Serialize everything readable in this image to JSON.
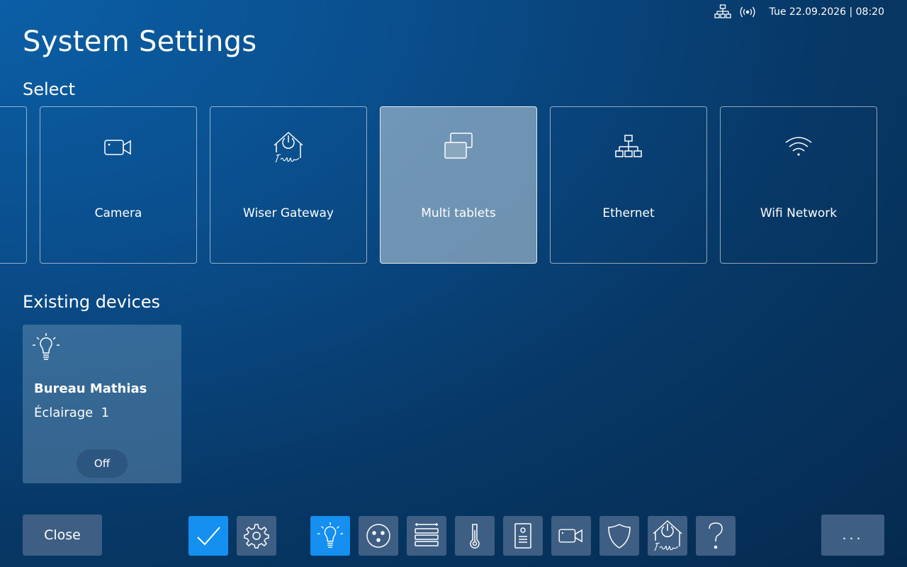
{
  "status": {
    "network_icon": "network-icon",
    "wireless_icon": "wireless-signal-icon",
    "datetime": "Tue 22.09.2026 | 08:20"
  },
  "page": {
    "title": "System Settings"
  },
  "select": {
    "heading": "Select",
    "tiles": [
      {
        "label": "",
        "icon": "none"
      },
      {
        "label": "Camera",
        "icon": "camera-icon"
      },
      {
        "label": "Wiser Gateway",
        "icon": "wiser-gateway-icon"
      },
      {
        "label": "Multi tablets",
        "icon": "multi-tablets-icon",
        "selected": true
      },
      {
        "label": "Ethernet",
        "icon": "ethernet-icon"
      },
      {
        "label": "Wifi Network",
        "icon": "wifi-icon"
      }
    ]
  },
  "devices": {
    "heading": "Existing devices",
    "items": [
      {
        "name": "Bureau Mathias",
        "subtitle": "Éclairage  1",
        "state": "Off",
        "icon": "lightbulb-icon"
      }
    ]
  },
  "bottom": {
    "close_label": "Close",
    "more_label": "...",
    "nav": [
      {
        "icon": "checkmark-icon",
        "active": true
      },
      {
        "icon": "gear-icon"
      },
      {
        "icon": "lightbulb-icon",
        "active": true
      },
      {
        "icon": "socket-icon"
      },
      {
        "icon": "blinds-icon"
      },
      {
        "icon": "thermometer-icon"
      },
      {
        "icon": "intercom-icon"
      },
      {
        "icon": "camera-icon"
      },
      {
        "icon": "shield-icon"
      },
      {
        "icon": "wiser-gateway-icon"
      },
      {
        "icon": "help-icon"
      }
    ]
  },
  "colors": {
    "accent": "#1590f0",
    "button": "#3f5e84",
    "selected_tile": "#9ab4c8"
  }
}
